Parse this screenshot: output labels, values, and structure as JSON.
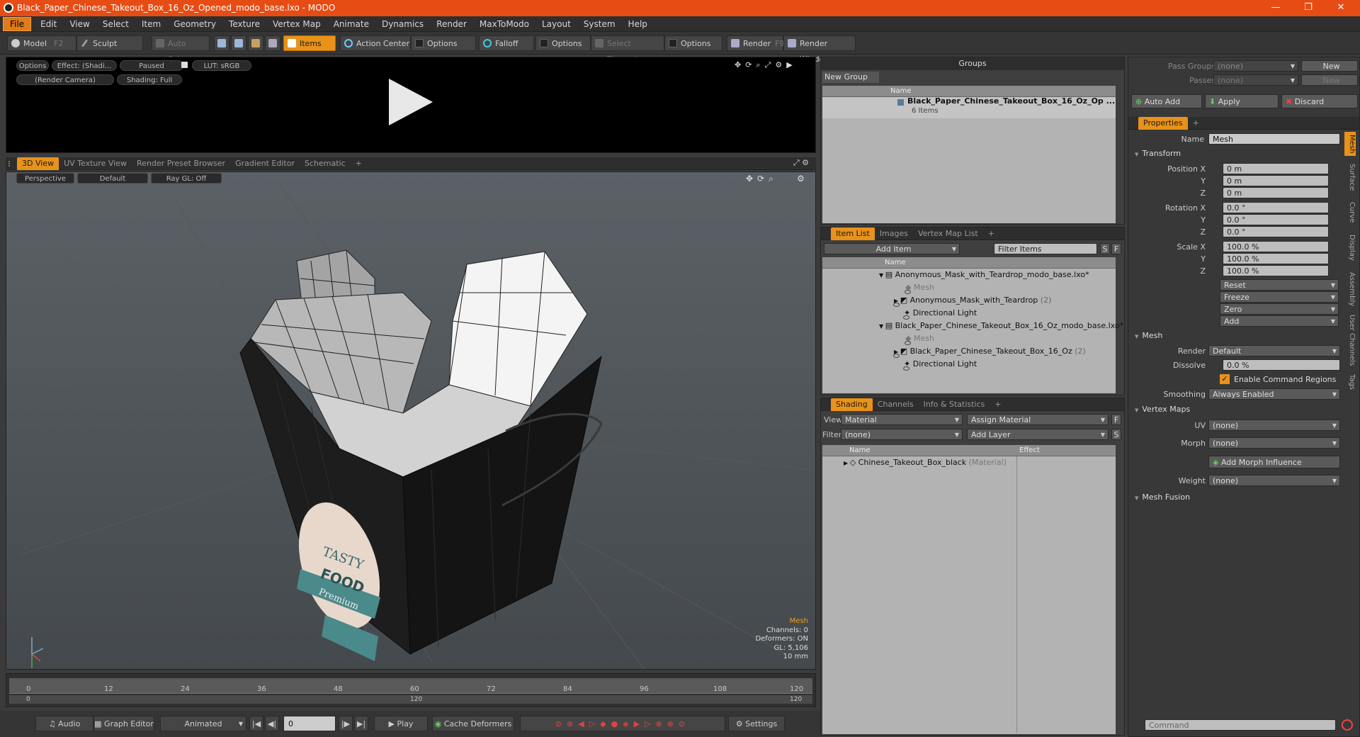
{
  "window": {
    "title": "Black_Paper_Chinese_Takeout_Box_16_Oz_Opened_modo_base.lxo - MODO",
    "accent": "#e64c14"
  },
  "menu": [
    "File",
    "Edit",
    "View",
    "Select",
    "Item",
    "Geometry",
    "Texture",
    "Vertex Map",
    "Animate",
    "Dynamics",
    "Render",
    "MaxToModo",
    "Layout",
    "System",
    "Help"
  ],
  "toolbar": {
    "model": "Model",
    "model_key": "F2",
    "sculpt": "Sculpt",
    "auto_select": "Auto Select",
    "items": "Items",
    "action_center": "Action Center",
    "options1": "Options",
    "falloff": "Falloff",
    "options2": "Options",
    "select_through": "Select Through",
    "options3": "Options",
    "render": "Render",
    "render_key": "F9",
    "render_window": "Render Window"
  },
  "preview": {
    "options": "Options",
    "effect": "Effect: (Shadi...",
    "paused": "Paused",
    "lut": "LUT: sRGB",
    "camera": "(Render Camera)",
    "shading": "Shading: Full"
  },
  "viewport_tabs": [
    "3D View",
    "UV Texture View",
    "Render Preset Browser",
    "Gradient Editor",
    "Schematic"
  ],
  "viewport": {
    "mode": "Perspective",
    "style": "Default",
    "raygl": "Ray GL: Off",
    "info": {
      "title": "Mesh",
      "channels": "Channels: 0",
      "deformers": "Deformers: ON",
      "gl": "GL: 5,106",
      "unit": "10 mm"
    }
  },
  "timeline": {
    "ticks": [
      "0",
      "12",
      "24",
      "36",
      "48",
      "60",
      "72",
      "84",
      "96",
      "108",
      "120"
    ],
    "sub": [
      "0",
      "120",
      "120"
    ]
  },
  "bottom": {
    "audio": "Audio",
    "graph": "Graph Editor",
    "animated": "Animated",
    "frame": "0",
    "play": "Play",
    "cache": "Cache Deformers",
    "settings": "Settings"
  },
  "groups": {
    "title": "Groups",
    "new_group": "New Group",
    "col_name": "Name",
    "item_name": "Black_Paper_Chinese_Takeout_Box_16_Oz_Op ...",
    "item_count": "6 Items"
  },
  "itemlist": {
    "tabs": [
      "Item List",
      "Images",
      "Vertex Map List"
    ],
    "add_item": "Add Item",
    "filter": "Filter Items",
    "col_name": "Name",
    "rows": [
      {
        "name": "Anonymous_Mask_with_Teardrop_modo_base.lxo*",
        "suffix": "",
        "indent": 0
      },
      {
        "name": "Mesh",
        "suffix": "",
        "indent": 2
      },
      {
        "name": "Anonymous_Mask_with_Teardrop",
        "suffix": "(2)",
        "indent": 1
      },
      {
        "name": "Directional Light",
        "suffix": "",
        "indent": 1
      },
      {
        "name": "Black_Paper_Chinese_Takeout_Box_16_Oz_modo_base.lxo*",
        "suffix": "",
        "indent": 0
      },
      {
        "name": "Mesh",
        "suffix": "",
        "indent": 2
      },
      {
        "name": "Black_Paper_Chinese_Takeout_Box_16_Oz",
        "suffix": "(2)",
        "indent": 1
      },
      {
        "name": "Directional Light",
        "suffix": "",
        "indent": 1
      }
    ]
  },
  "shading": {
    "tabs": [
      "Shading",
      "Channels",
      "Info & Statistics"
    ],
    "view_label": "View",
    "view_value": "Material",
    "assign": "Assign Material",
    "filter_label": "Filter",
    "filter_value": "(none)",
    "add_layer": "Add Layer",
    "col_name": "Name",
    "col_effect": "Effect",
    "row_name": "Chinese_Takeout_Box_black",
    "row_type": "(Material)"
  },
  "pass": {
    "pass_groups": "Pass Groups",
    "passes": "Passes",
    "none": "(none)",
    "new": "New",
    "auto_add": "Auto Add",
    "apply": "Apply",
    "discard": "Discard"
  },
  "properties": {
    "tab": "Properties",
    "name_label": "Name",
    "name_value": "Mesh",
    "transform": "Transform",
    "position_label": "Position X",
    "rotation_label": "Rotation X",
    "scale_label": "Scale X",
    "y": "Y",
    "z": "Z",
    "pos": [
      "0 m",
      "0 m",
      "0 m"
    ],
    "rot": [
      "0.0 °",
      "0.0 °",
      "0.0 °"
    ],
    "scale": [
      "100.0 %",
      "100.0 %",
      "100.0 %"
    ],
    "reset": "Reset",
    "freeze": "Freeze",
    "zero": "Zero",
    "add": "Add",
    "mesh": "Mesh",
    "render_label": "Render",
    "render_value": "Default",
    "dissolve_label": "Dissolve",
    "dissolve_value": "0.0 %",
    "enable_cmd": "Enable Command Regions",
    "smoothing_label": "Smoothing",
    "smoothing_value": "Always Enabled",
    "vertex_maps": "Vertex Maps",
    "uv_label": "UV",
    "uv_value": "(none)",
    "morph_label": "Morph",
    "morph_value": "(none)",
    "add_morph": "Add Morph Influence",
    "weight_label": "Weight",
    "weight_value": "(none)",
    "mesh_fusion": "Mesh Fusion",
    "command": "Command"
  },
  "side_tabs": [
    "Mesh",
    "Surface",
    "Curve",
    "Display",
    "Assembly",
    "User Channels",
    "Tags"
  ]
}
